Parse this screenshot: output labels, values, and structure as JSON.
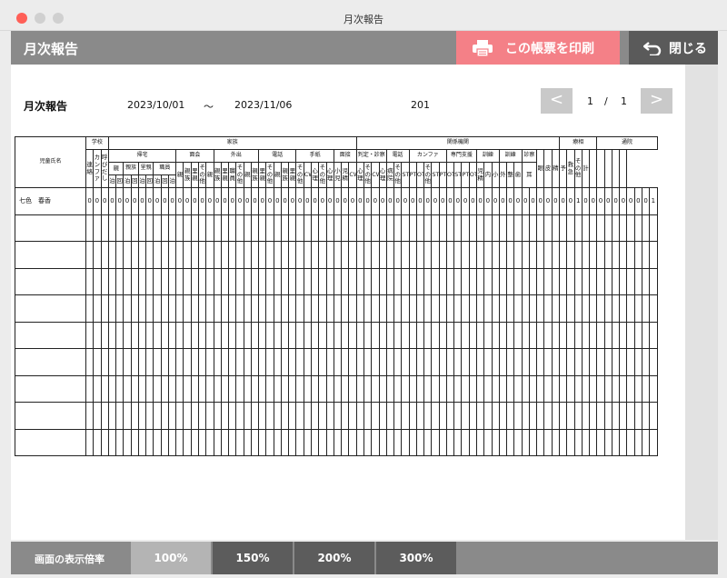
{
  "window": {
    "title": "月次報告"
  },
  "appbar": {
    "title": "月次報告",
    "print_label": "この帳票を印刷",
    "close_label": "閉じる"
  },
  "report": {
    "title": "月次報告",
    "date_from": "2023/10/01",
    "date_sep": "〜",
    "date_to": "2023/11/06",
    "code": "201"
  },
  "pager": {
    "prev": "<",
    "current": "1",
    "sep": "/",
    "total": "1",
    "next": ">"
  },
  "table": {
    "name_header": "児童氏名",
    "groups": [
      "学校",
      "家族",
      "関係機関",
      "療相",
      "通院"
    ],
    "subgroups": [
      "帰宅",
      "面会",
      "外出",
      "電話",
      "手紙",
      "面接",
      "判定・診察",
      "電話",
      "カンファ",
      "専門支援",
      "訓練",
      "訓練",
      "診察"
    ],
    "mid_labels": [
      "親族",
      "里親",
      "職員"
    ],
    "stay_labels": [
      "泊",
      "回"
    ],
    "leaf_labels": [
      "連絡",
      "カンファ",
      "呼びだし",
      "親",
      "親",
      "親族",
      "里親",
      "その他",
      "親",
      "親族",
      "里親",
      "職員",
      "その他",
      "親",
      "親族",
      "里親",
      "その他",
      "親",
      "親族",
      "里親",
      "その他",
      "CW",
      "心理",
      "その他",
      "心理",
      "小児",
      "児精",
      "CW",
      "心理",
      "その他",
      "CW",
      "心理",
      "病院",
      "その他",
      "ST",
      "PT",
      "OT",
      "その他",
      "ST",
      "PT",
      "OT",
      "ST",
      "PT",
      "OT",
      "児精",
      "内",
      "小",
      "外",
      "整",
      "歯",
      "耳",
      "眼",
      "皮",
      "精",
      "予",
      "救急",
      "その他",
      "計"
    ],
    "rows": [
      {
        "name": "七色　春香",
        "values": [
          "0",
          "0",
          "0",
          "0",
          "0",
          "0",
          "0",
          "0",
          "0",
          "0",
          "0",
          "0",
          "0",
          "0",
          "0",
          "0",
          "0",
          "0",
          "0",
          "0",
          "0",
          "0",
          "0",
          "0",
          "0",
          "0",
          "0",
          "0",
          "0",
          "0",
          "0",
          "0",
          "0",
          "0",
          "0",
          "0",
          "0",
          "0",
          "0",
          "0",
          "0",
          "0",
          "0",
          "0",
          "0",
          "0",
          "0",
          "0",
          "0",
          "0",
          "0",
          "0",
          "0",
          "0",
          "0",
          "0",
          "0",
          "0",
          "0",
          "0",
          "0",
          "0",
          "0",
          "0",
          "0",
          "1",
          "0",
          "0",
          "0",
          "0",
          "0",
          "0",
          "0",
          "0",
          "0",
          "1"
        ]
      },
      {
        "name": "",
        "values": []
      },
      {
        "name": "",
        "values": []
      },
      {
        "name": "",
        "values": []
      },
      {
        "name": "",
        "values": []
      },
      {
        "name": "",
        "values": []
      },
      {
        "name": "",
        "values": []
      },
      {
        "name": "",
        "values": []
      },
      {
        "name": "",
        "values": []
      },
      {
        "name": "",
        "values": []
      }
    ]
  },
  "zoom": {
    "label": "画面の表示倍率",
    "options": [
      "100%",
      "150%",
      "200%",
      "300%"
    ],
    "selected": "100%"
  },
  "colors": {
    "appbar": "#8a8a8a",
    "print": "#f48087",
    "close": "#5a5a5a",
    "zoom_selected": "#b4b4b4",
    "zoom_other": "#5c5c5c"
  }
}
